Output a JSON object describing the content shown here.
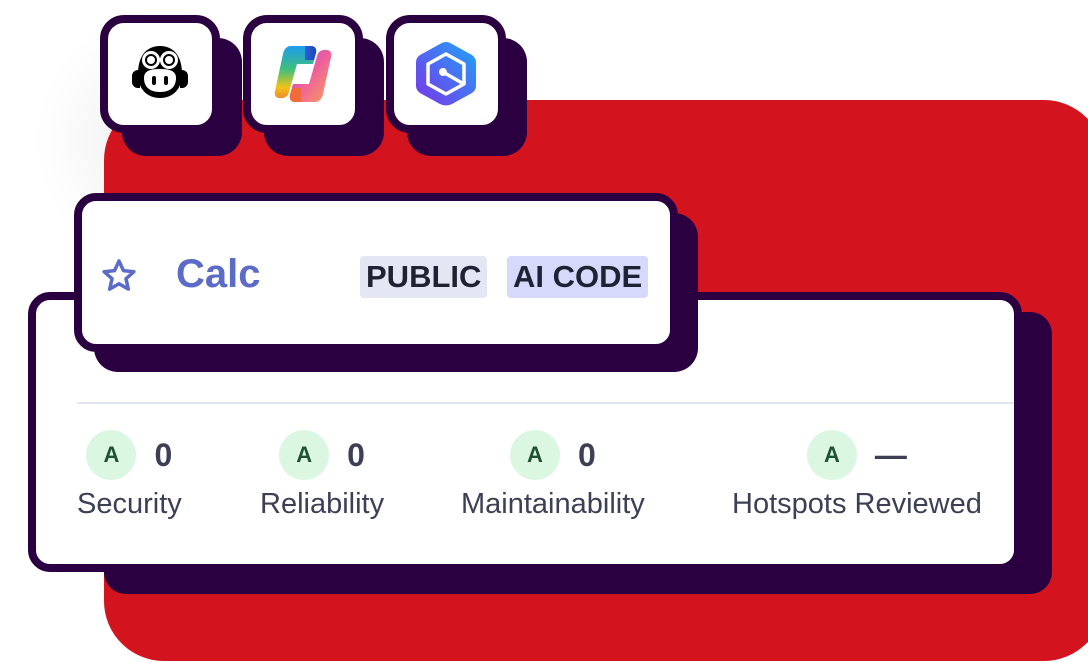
{
  "colors": {
    "background": "#ffffff",
    "red_panel": "#d3141f",
    "outline": "#2b0040",
    "accent": "#5c6bc8",
    "grade_bg": "#dcf7e1",
    "grade_text": "#1e5232",
    "tag_public_bg": "#e3e7f3",
    "tag_ai_bg": "#d6d9fb"
  },
  "integrations": [
    {
      "name": "GitHub Copilot",
      "icon": "copilot-icon"
    },
    {
      "name": "Microsoft Copilot",
      "icon": "ms-copilot-icon"
    },
    {
      "name": "Hexagon AI assistant",
      "icon": "hexagon-ai-icon"
    }
  ],
  "project": {
    "name": "Calc",
    "favorite_icon": "star-outline-icon",
    "tags": [
      "PUBLIC",
      "AI CODE"
    ]
  },
  "metrics": [
    {
      "label": "Security",
      "grade": "A",
      "value": "0"
    },
    {
      "label": "Reliability",
      "grade": "A",
      "value": "0"
    },
    {
      "label": "Maintainability",
      "grade": "A",
      "value": "0"
    },
    {
      "label": "Hotspots Reviewed",
      "grade": "A",
      "value": "—"
    }
  ]
}
